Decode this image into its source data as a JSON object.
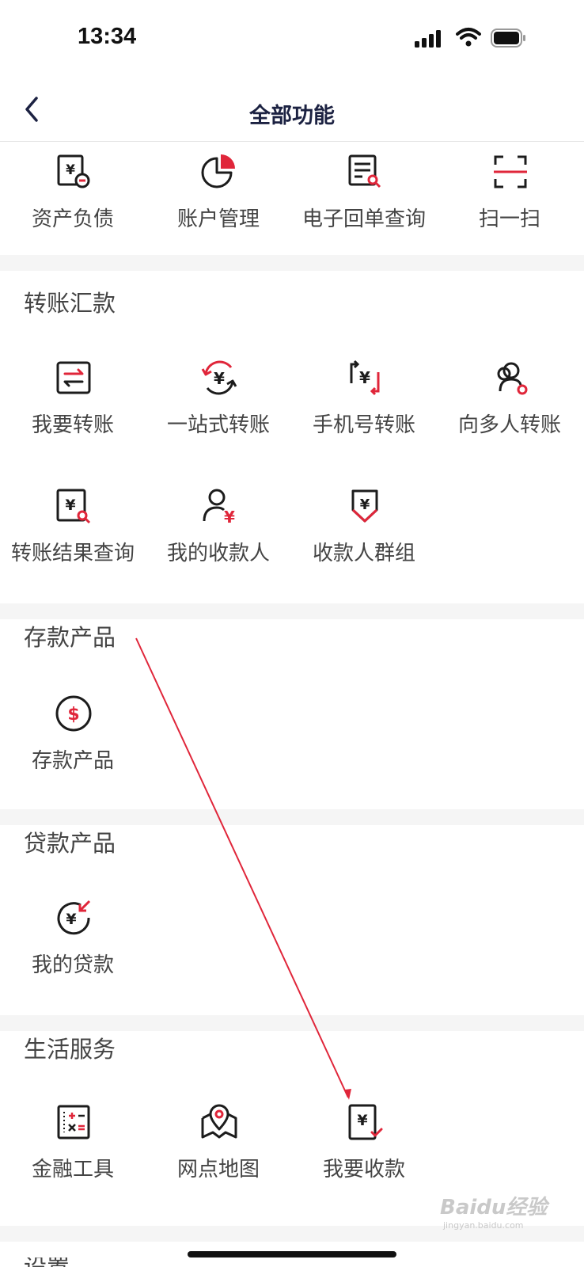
{
  "status_bar": {
    "time": "13:34"
  },
  "nav": {
    "title": "全部功能"
  },
  "top_items": [
    "资产负债",
    "账户管理",
    "电子回单查询",
    "扫一扫"
  ],
  "sections": [
    {
      "title": "转账汇款",
      "items": [
        "我要转账",
        "一站式转账",
        "手机号转账",
        "向多人转账",
        "转账结果查询",
        "我的收款人",
        "收款人群组"
      ]
    },
    {
      "title": "存款产品",
      "items": [
        "存款产品"
      ]
    },
    {
      "title": "贷款产品",
      "items": [
        "我的贷款"
      ]
    },
    {
      "title": "生活服务",
      "items": [
        "金融工具",
        "网点地图",
        "我要收款"
      ]
    },
    {
      "title": "设置"
    }
  ],
  "colors": {
    "accent": "#e0263a",
    "icon": "#1c1c1c",
    "title": "#1c2242"
  },
  "watermark": {
    "brand": "Baidu经验",
    "url": "jingyan.baidu.com"
  }
}
